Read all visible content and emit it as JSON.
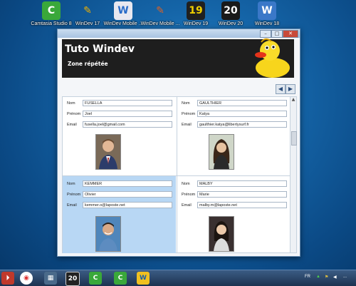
{
  "desktop": {
    "icons": [
      {
        "label": "Camtasia Studio 8",
        "glyph": "C",
        "icon": "camtasia-icon"
      },
      {
        "label": "WinDev 17",
        "glyph": "✎",
        "icon": "windev17-icon"
      },
      {
        "label": "WinDev Mobile ...",
        "glyph": "W",
        "icon": "windev-mobile-icon"
      },
      {
        "label": "WinDev Mobile ...",
        "glyph": "✎",
        "icon": "windev-mobile-pen-icon"
      },
      {
        "label": "WinDev 19",
        "glyph": "19",
        "icon": "windev19-icon"
      },
      {
        "label": "WinDev 20",
        "glyph": "20",
        "icon": "windev20-icon"
      },
      {
        "label": "WinDev 18",
        "glyph": "W",
        "icon": "windev18-icon"
      }
    ]
  },
  "window": {
    "controls": {
      "minimize": "–",
      "maximize": "□",
      "close": "✕"
    },
    "title": "Tuto Windev",
    "subtitle": "Zone répétée",
    "nav": {
      "prev": "◀",
      "next": "▶"
    }
  },
  "records": [
    {
      "nom": "FUSELLA",
      "prenom": "Joel",
      "email": "fusella.joel@gmail.com",
      "photo_bg": "#6a5a4a"
    },
    {
      "nom": "GAULTHIER",
      "prenom": "Katya",
      "email": "gaulthier.katya@libertysurf.fr",
      "photo_bg": "#3a2a1e"
    },
    {
      "nom": "KEMMER",
      "prenom": "Olivier",
      "email": "kemmer.o@laposte.net",
      "photo_bg": "#3b6ea0"
    },
    {
      "nom": "MALBY",
      "prenom": "Marie",
      "email": "malby.m@laposte.net",
      "photo_bg": "#2a2020"
    }
  ],
  "labels": {
    "nom": "Nom",
    "prenom": "Prénom",
    "email": "Email"
  },
  "taskbar": {
    "items": [
      "⏵",
      "◉",
      "▦",
      "20",
      "C",
      "C",
      "W"
    ],
    "lang": "FR",
    "time": "..."
  },
  "colors": {
    "selected_row": "#b8d7f4",
    "header_band": "#1e1e1e"
  }
}
